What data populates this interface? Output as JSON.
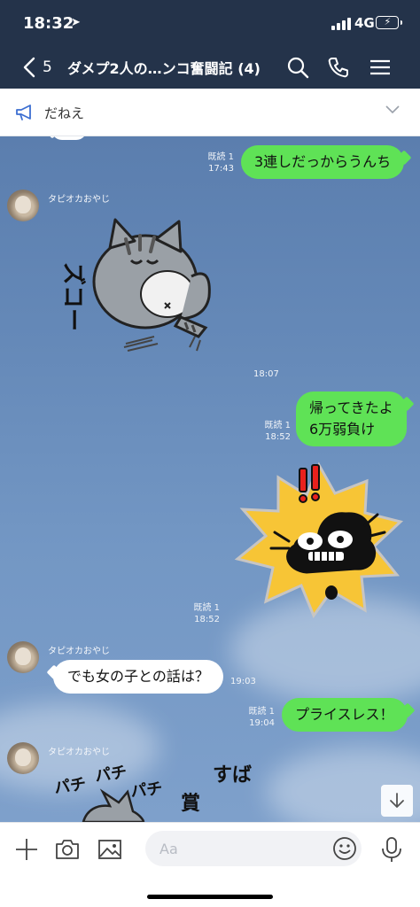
{
  "status_bar": {
    "time": "18:32",
    "location_glyph": "➤",
    "network": "4G",
    "battery_color": "#3ccd5a"
  },
  "header": {
    "back_count": "5",
    "title": "ダメプ2人の…ンコ奮闘記 (4)",
    "icons": [
      "search-icon",
      "phone-icon",
      "menu-icon"
    ],
    "background": "#24334a"
  },
  "announcement": {
    "text": "だねえ",
    "icon": "megaphone-icon"
  },
  "messages": [
    {
      "id": "m1",
      "direction": "out",
      "type": "text",
      "text": "3連しだっからうんち",
      "read": "既読 1",
      "time": "17:43"
    },
    {
      "id": "m2",
      "direction": "in",
      "type": "sticker",
      "sender": "タピオカおやじ",
      "sticker": "gray-tabby-cat-sliding-sticker",
      "sticker_text": "ズコー",
      "time": "18:07"
    },
    {
      "id": "m3",
      "direction": "out",
      "type": "text",
      "text_lines": [
        "帰ってきたよ",
        "6万弱負け"
      ],
      "read": "既読 1",
      "time": "18:52"
    },
    {
      "id": "m4",
      "direction": "out",
      "type": "sticker",
      "sticker": "shocked-skeleton-cat-sticker",
      "read": "既読 1",
      "time": "18:52"
    },
    {
      "id": "m5",
      "direction": "in",
      "type": "text",
      "sender": "タピオカおやじ",
      "text": "でも女の子との話は？",
      "time": "19:03"
    },
    {
      "id": "m6",
      "direction": "out",
      "type": "text",
      "text": "プライスレス！",
      "read": "既読 1",
      "time": "19:04"
    },
    {
      "id": "m7",
      "direction": "in",
      "type": "sticker",
      "sender": "タピオカおやじ",
      "sticker": "clapping-cat-sticker",
      "sticker_text": [
        "パチ",
        "パチ",
        "パチ",
        "すば",
        "賞"
      ]
    }
  ],
  "input_bar": {
    "placeholder": "Aa",
    "icons": [
      "plus-icon",
      "camera-icon",
      "image-icon",
      "emoji-icon",
      "microphone-icon"
    ]
  },
  "colors": {
    "outgoing_bubble": "#5fe256",
    "incoming_bubble": "#ffffff",
    "chat_background": "#6589b8"
  }
}
